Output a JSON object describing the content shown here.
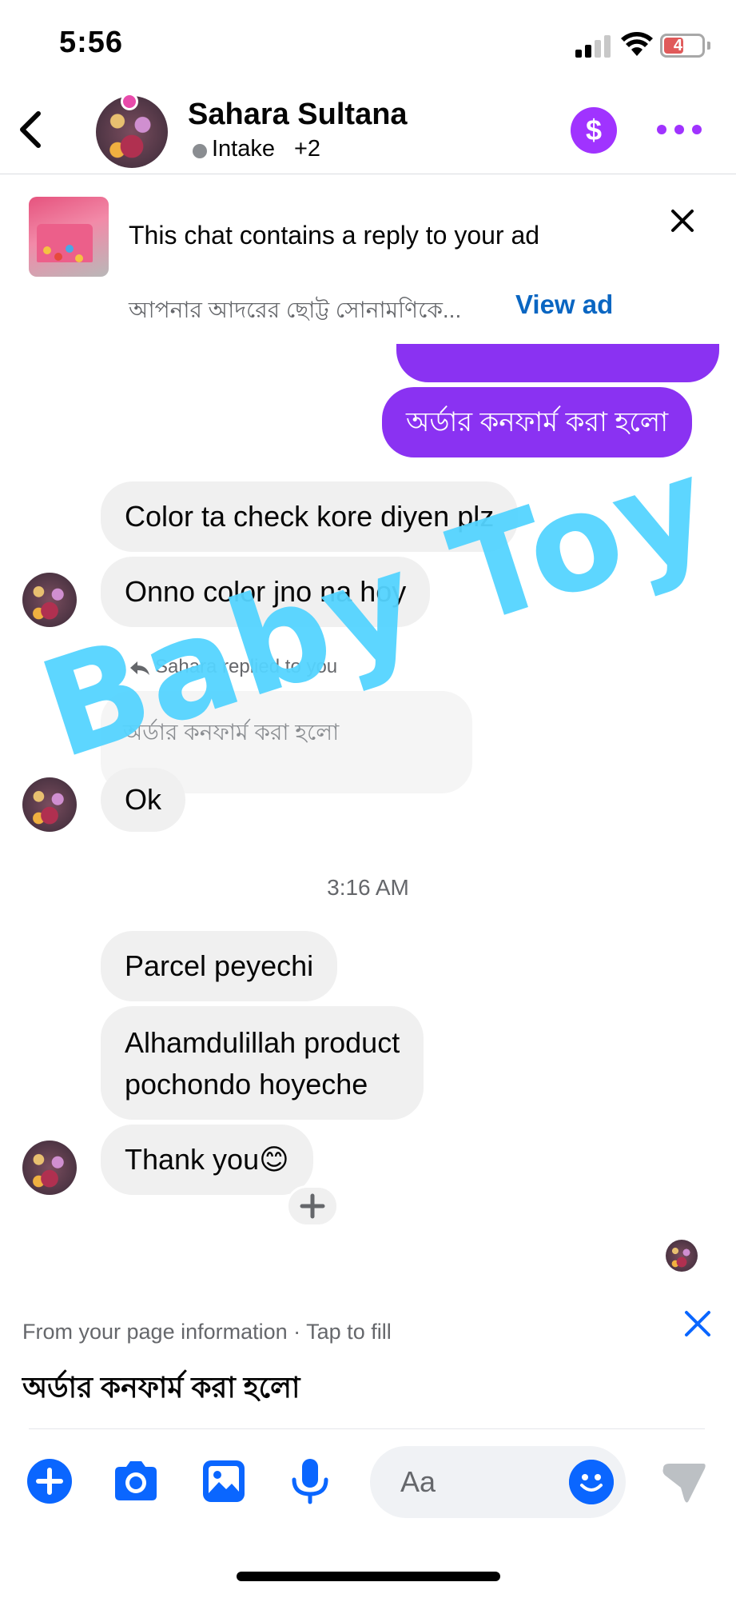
{
  "status_bar": {
    "time": "5:56",
    "battery": "47"
  },
  "header": {
    "contact_name": "Sahara Sultana",
    "label": "Intake",
    "label_more": "+2",
    "accent_color": "#a033ff"
  },
  "ad_banner": {
    "title": "This chat contains a reply to your ad",
    "subtitle": "আপনার আদরের ছোট্ট সোনামণিকে...",
    "view_label": "View ad"
  },
  "messages": {
    "outgoing_1": "অর্ডার কনফার্ম করা হলো",
    "incoming_1": "Color ta check kore diyen plz",
    "incoming_2": "Onno color jno na hoy",
    "reply_header": "Sahara replied to you",
    "quoted_text": "অর্ডার কনফার্ম করা হলো",
    "incoming_3": "Ok",
    "timestamp": "3:16 AM",
    "incoming_4": "Parcel peyechi",
    "incoming_5_line1": "Alhamdulillah product",
    "incoming_5_line2": "pochondo hoyeche",
    "incoming_6": "Thank you😊"
  },
  "watermark": {
    "text": "Baby Toy",
    "color": "#55d4ff"
  },
  "suggestion": {
    "label": "From your page information · Tap to fill",
    "text": "অর্ডার কনফার্ম করা হলো"
  },
  "composer": {
    "placeholder": "Aa",
    "icons": [
      "plus-icon",
      "camera-icon",
      "gallery-icon",
      "microphone-icon",
      "emoji-icon",
      "send-icon"
    ],
    "accent_color": "#0a66ff"
  }
}
